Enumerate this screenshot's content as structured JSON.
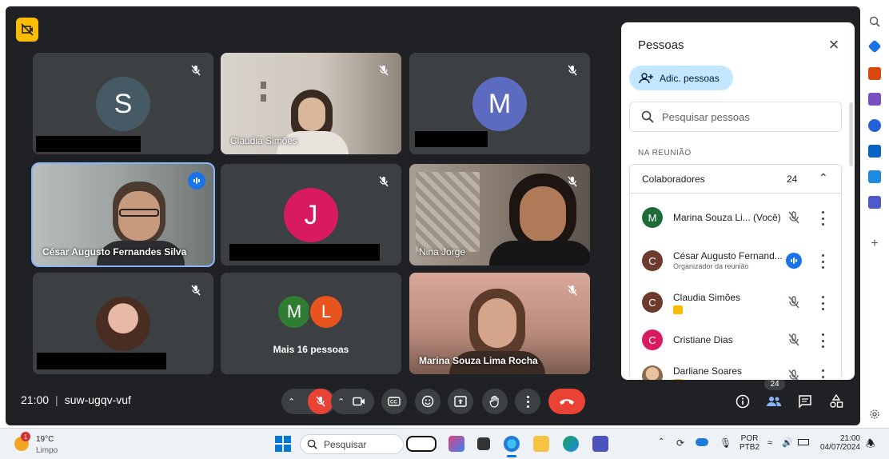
{
  "meeting": {
    "time": "21:00",
    "code": "suw-ugqv-vuf",
    "more_people_label": "Mais 16 pessoas",
    "tiles": [
      {
        "initial": "S",
        "color": "#455a64",
        "name": ""
      },
      {
        "initial": "",
        "color": "",
        "name": "Claudia Simões"
      },
      {
        "initial": "M",
        "color": "#5c6bc0",
        "name": ""
      },
      {
        "initial": "",
        "color": "",
        "name": "César Augusto Fernandes Silva"
      },
      {
        "initial": "J",
        "color": "#d81b60",
        "name": ""
      },
      {
        "initial": "",
        "color": "",
        "name": "Nina Jorge"
      },
      {
        "initial": "",
        "color": "",
        "name": ""
      },
      {
        "initial": "",
        "color": "",
        "name": "Mais 16 pessoas"
      },
      {
        "initial": "",
        "color": "",
        "name": "Marina Souza Lima Rocha"
      }
    ],
    "group_avatars": [
      {
        "initial": "M",
        "color": "#2e7d32"
      },
      {
        "initial": "L",
        "color": "#e8541e"
      }
    ],
    "participants_badge": "24"
  },
  "panel": {
    "title": "Pessoas",
    "add_button": "Adic. pessoas",
    "search_placeholder": "Pesquisar pessoas",
    "section_label": "NA REUNIÃO",
    "group_label": "Colaboradores",
    "group_count": "24",
    "people": [
      {
        "initial": "M",
        "color": "#1e6b3a",
        "name": "Marina Souza Li...  (Você)",
        "sub": "",
        "state": "muted"
      },
      {
        "initial": "C",
        "color": "#6d3a2e",
        "name": "César Augusto Fernand...",
        "sub": "Organizador da reunião",
        "state": "speaking"
      },
      {
        "initial": "C",
        "color": "#6d3a2e",
        "name": "Claudia Simões",
        "sub": "",
        "state": "muted"
      },
      {
        "initial": "C",
        "color": "#d81b60",
        "name": "Cristiane Dias",
        "sub": "",
        "state": "muted"
      },
      {
        "initial": "",
        "color": "#c9a27a",
        "name": "Darliane Soares",
        "sub": "",
        "state": "muted"
      }
    ]
  },
  "taskbar": {
    "temperature": "19°C",
    "condition": "Limpo",
    "weather_badge": "1",
    "search_placeholder": "Pesquisar",
    "lang_top": "POR",
    "lang_bottom": "PTB2",
    "clock_time": "21:00",
    "clock_date": "04/07/2024"
  }
}
